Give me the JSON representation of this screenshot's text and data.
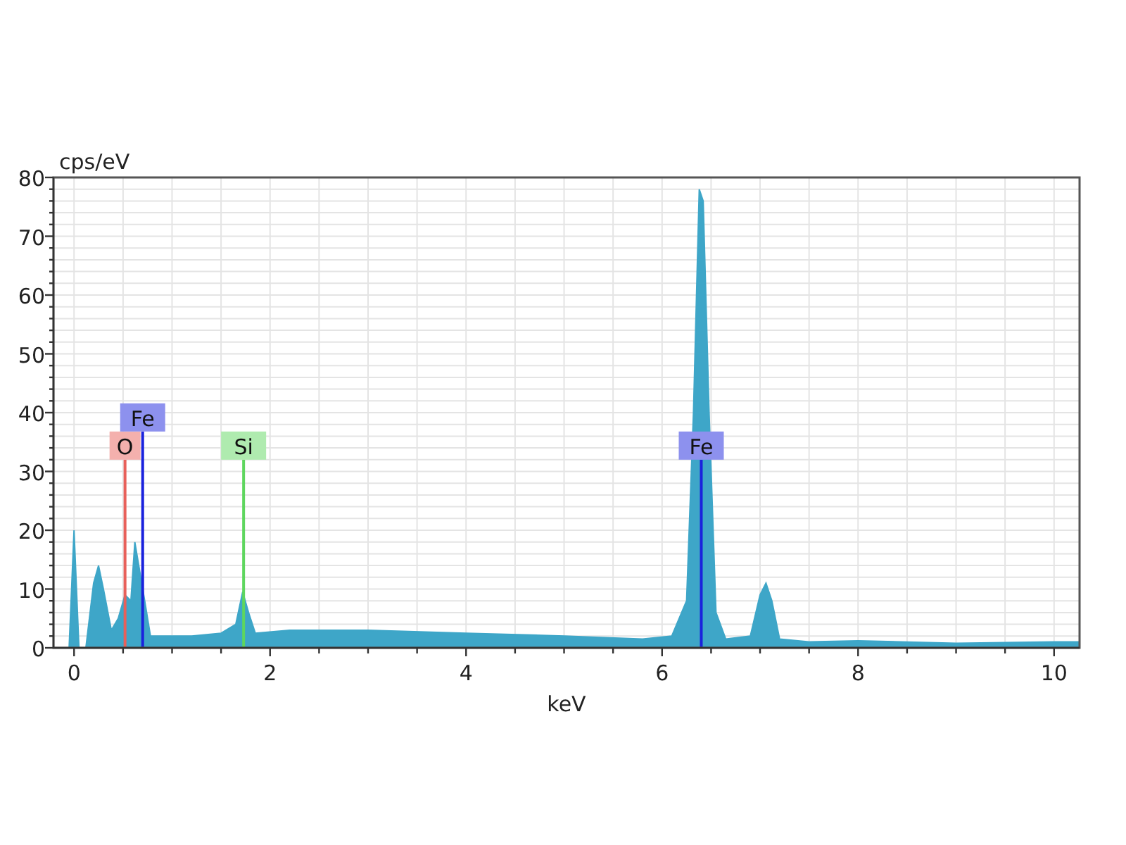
{
  "chart": {
    "chart_data": {
      "type": "area",
      "xlabel": "keV",
      "ylabel": "cps/eV",
      "xlim": [
        -0.21,
        10.26
      ],
      "ylim": [
        0,
        80
      ],
      "xticks": [
        0,
        2,
        4,
        6,
        8,
        10
      ],
      "yticks": [
        0,
        10,
        20,
        30,
        40,
        50,
        60,
        70,
        80
      ],
      "x": [
        -0.05,
        0,
        0.05,
        0.12,
        0.2,
        0.25,
        0.3,
        0.38,
        0.45,
        0.52,
        0.58,
        0.62,
        0.66,
        0.72,
        0.78,
        0.9,
        1.2,
        1.5,
        1.65,
        1.72,
        1.78,
        1.85,
        2.2,
        3,
        4,
        5,
        5.8,
        6.1,
        6.25,
        6.32,
        6.38,
        6.42,
        6.48,
        6.55,
        6.65,
        6.9,
        7,
        7.06,
        7.12,
        7.2,
        7.5,
        8,
        9,
        10,
        10.26
      ],
      "grid": true,
      "series": [
        {
          "color": "#3ea6c8",
          "values": [
            0,
            20,
            0,
            0,
            11,
            14,
            10,
            3,
            5,
            9,
            8,
            18,
            14,
            8,
            2,
            2,
            2,
            2.5,
            4,
            9.5,
            6,
            2.5,
            3,
            3,
            2.5,
            2,
            1.5,
            2,
            8,
            40,
            78,
            76,
            40,
            6,
            1.5,
            2,
            9,
            11,
            8,
            1.5,
            1,
            1.2,
            0.8,
            1,
            1
          ]
        }
      ],
      "ref_lines": [
        {
          "axis": "x",
          "value": 0.52,
          "label": "O",
          "color": "#e8605a"
        },
        {
          "axis": "x",
          "value": 0.7,
          "label": "Fe",
          "color": "#1a22dd"
        },
        {
          "axis": "x",
          "value": 1.73,
          "label": "Si",
          "color": "#5ed65e"
        },
        {
          "axis": "x",
          "value": 6.4,
          "label": "Fe",
          "color": "#1a22dd"
        }
      ]
    }
  }
}
